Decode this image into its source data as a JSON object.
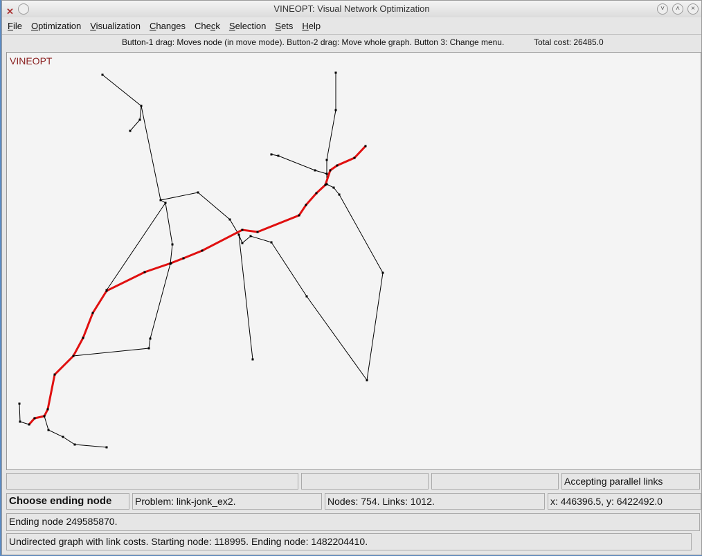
{
  "window": {
    "title": "VINEOPT: Visual Network Optimization",
    "app_icon": "x-logo-icon",
    "controls": [
      "minimize",
      "maximize",
      "close"
    ]
  },
  "menu": [
    {
      "label": "File",
      "u": "F",
      "rest": "ile"
    },
    {
      "label": "Optimization",
      "u": "O",
      "rest": "ptimization"
    },
    {
      "label": "Visualization",
      "u": "V",
      "rest": "isualization"
    },
    {
      "label": "Changes",
      "u": "C",
      "rest": "hanges"
    },
    {
      "label": "Check",
      "pre": "Che",
      "u": "c",
      "rest": "k"
    },
    {
      "label": "Selection",
      "u": "S",
      "rest": "election"
    },
    {
      "label": "Sets",
      "u": "S",
      "rest": "ets"
    },
    {
      "label": "Help",
      "u": "H",
      "rest": "elp"
    }
  ],
  "info": {
    "hint": "Button-1 drag: Moves node (in move mode). Button-2 drag: Move whole graph. Button 3: Change menu.",
    "total_cost": "Total cost: 26485.0"
  },
  "canvas": {
    "brand": "VINEOPT",
    "path_color": "#e01010",
    "edge_color": "#000000"
  },
  "status": {
    "row1": [
      "",
      "",
      "",
      "Accepting parallel links"
    ],
    "mode": "Choose ending node",
    "problem": "Problem: link-jonk_ex2.",
    "counts": "Nodes: 754. Links: 1012.",
    "coords": "x: 446396.5, y: 6422492.0",
    "message": "Ending node 249585870.",
    "summary": "Undirected graph with link costs. Starting node: 118995. Ending node: 1482204410."
  }
}
